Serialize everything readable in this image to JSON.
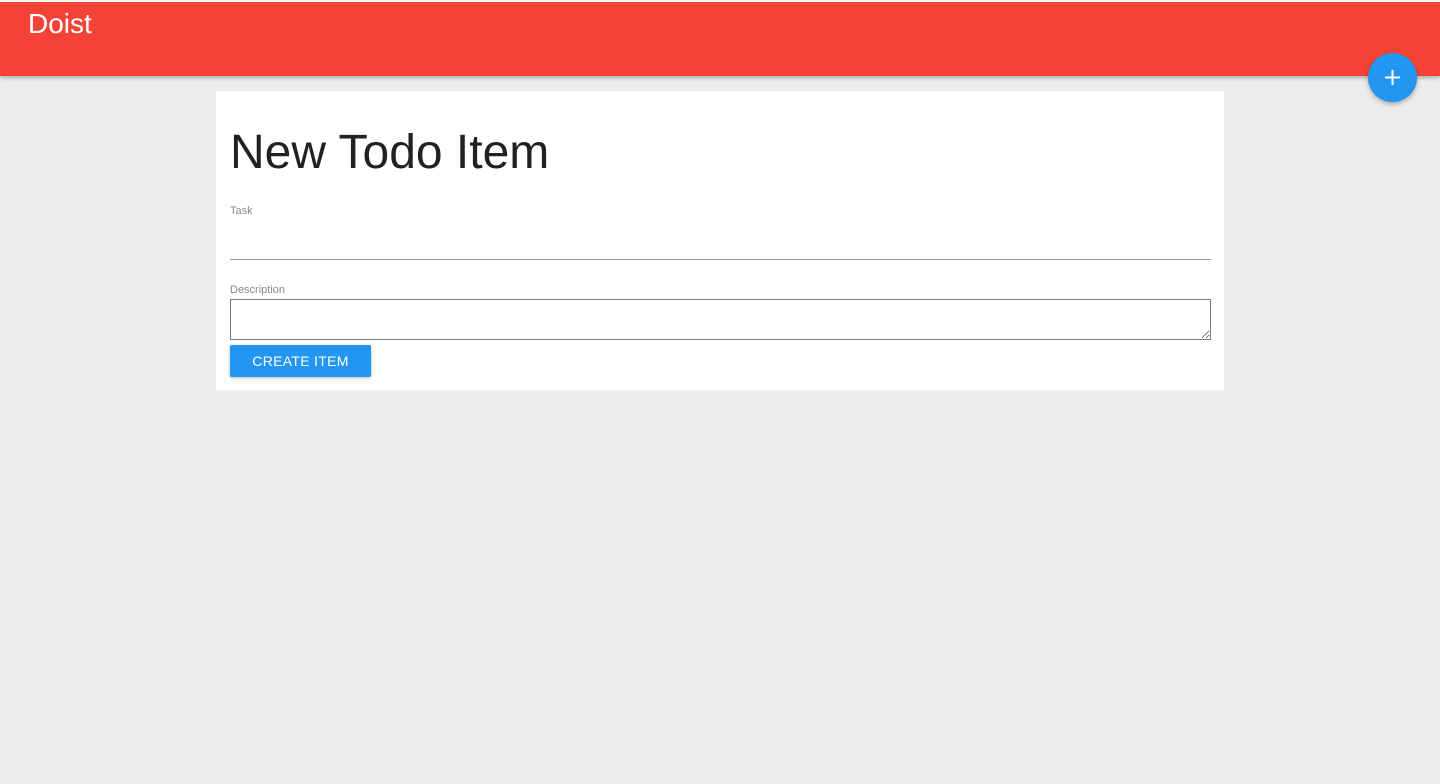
{
  "app_bar": {
    "title": "Doist",
    "color": "#f44336"
  },
  "fab": {
    "icon": "plus-icon",
    "color": "#2196f3"
  },
  "form": {
    "title": "New Todo Item",
    "task_label": "Task",
    "task_value": "",
    "task_placeholder": "",
    "description_label": "Description",
    "description_value": "",
    "submit_label": "CREATE ITEM"
  },
  "colors": {
    "background": "#ececec",
    "card": "#ffffff",
    "accent": "#2196f3",
    "brand": "#f44336"
  }
}
